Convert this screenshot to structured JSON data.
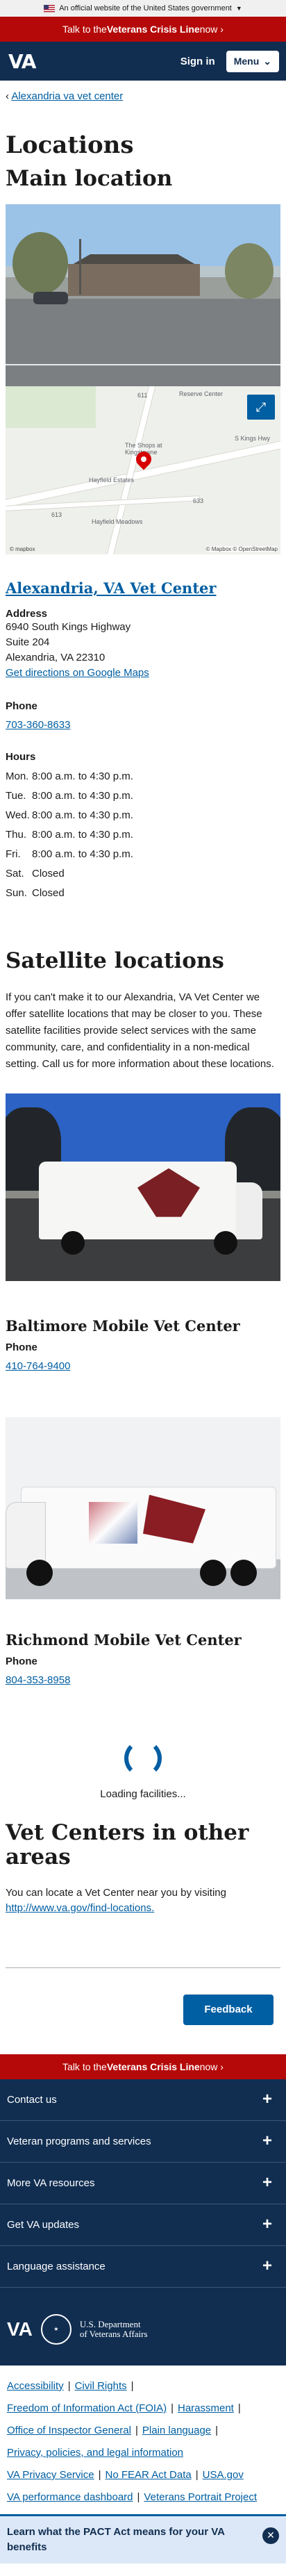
{
  "gov_banner": {
    "text": "An official website of the United States government"
  },
  "crisis_line": {
    "prefix": "Talk to the ",
    "bold": "Veterans Crisis Line",
    "suffix": " now"
  },
  "header": {
    "logo": "VA",
    "sign_in": "Sign in",
    "menu": "Menu"
  },
  "breadcrumb": {
    "back_link": "Alexandria va vet center"
  },
  "page": {
    "title": "Locations",
    "main_location_heading": "Main location"
  },
  "map": {
    "labels": [
      "Reserve Center",
      "The Shops at Kingstowne",
      "Hayfield Estates",
      "Hayfield Meadows",
      "S Kings Hwy",
      "611",
      "633",
      "613"
    ],
    "attribution": "© Mapbox © OpenStreetMap",
    "logo": "© mapbox"
  },
  "facility": {
    "name": "Alexandria, VA Vet Center",
    "address_label": "Address",
    "address_lines": [
      "6940 South Kings Highway",
      "Suite 204",
      "Alexandria, VA 22310"
    ],
    "directions": "Get directions on Google Maps",
    "phone_label": "Phone",
    "phone": "703-360-8633",
    "hours_label": "Hours",
    "hours": [
      {
        "day": "Mon.",
        "time": "8:00 a.m. to 4:30 p.m."
      },
      {
        "day": "Tue.",
        "time": "8:00 a.m. to 4:30 p.m."
      },
      {
        "day": "Wed.",
        "time": "8:00 a.m. to 4:30 p.m."
      },
      {
        "day": "Thu.",
        "time": "8:00 a.m. to 4:30 p.m."
      },
      {
        "day": "Fri.",
        "time": "8:00 a.m. to 4:30 p.m."
      },
      {
        "day": "Sat.",
        "time": "Closed"
      },
      {
        "day": "Sun.",
        "time": "Closed"
      }
    ]
  },
  "satellite": {
    "heading": "Satellite locations",
    "intro": "If you can't make it to our Alexandria, VA Vet Center we offer satellite locations that may be closer to you. These satellite facilities provide select services with the same community, care, and confidentiality in a non-medical setting. Call us for more information about these locations.",
    "locations": [
      {
        "name": "Baltimore Mobile Vet Center",
        "phone_label": "Phone",
        "phone": "410-764-9400"
      },
      {
        "name": "Richmond Mobile Vet Center",
        "phone_label": "Phone",
        "phone": "804-353-8958"
      }
    ],
    "loading": "Loading facilities..."
  },
  "other_areas": {
    "heading": "Vet Centers in other areas",
    "text": "You can locate a Vet Center near you by visiting",
    "link": "http://www.va.gov/find-locations."
  },
  "feedback": {
    "label": "Feedback"
  },
  "footer": {
    "accordion": [
      "Contact us",
      "Veteran programs and services",
      "More VA resources",
      "Get VA updates",
      "Language assistance"
    ],
    "logo": "VA",
    "dept_line1": "U.S. Department",
    "dept_line2": "of Veterans Affairs",
    "links": [
      [
        "Accessibility",
        "Civil Rights"
      ],
      [
        "Freedom of Information Act (FOIA)",
        "Harassment"
      ],
      [
        "Office of Inspector General",
        "Plain language"
      ],
      [
        "Privacy, policies, and legal information"
      ],
      [
        "VA Privacy Service",
        "No FEAR Act Data",
        "USA.gov"
      ],
      [
        "VA performance dashboard",
        "Veterans Portrait Project"
      ]
    ]
  },
  "pact_banner": {
    "text": "Learn what the PACT Act means for your VA benefits"
  },
  "colors": {
    "navy": "#112e51",
    "crisis_red": "#b50909",
    "link_blue": "#005ea2"
  }
}
